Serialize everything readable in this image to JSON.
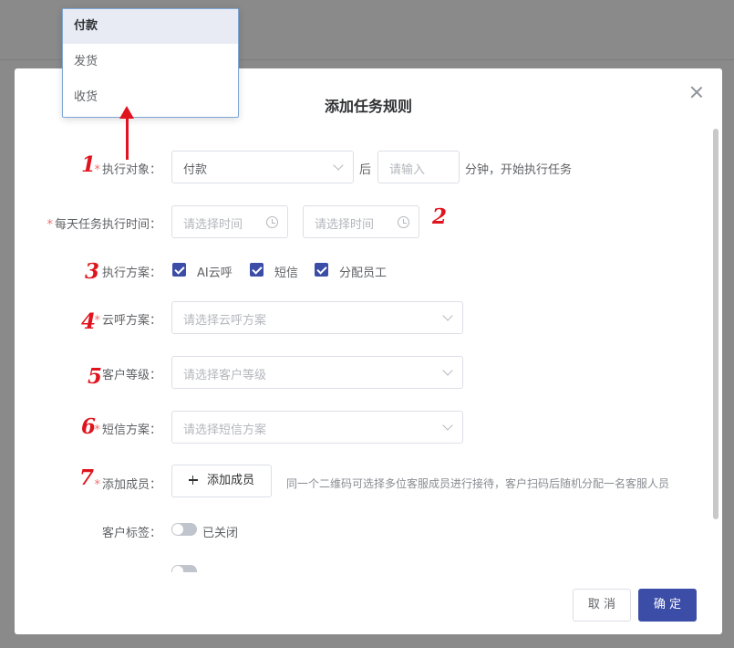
{
  "dialog": {
    "title": "添加任务规则",
    "close_icon": "close-icon"
  },
  "form": {
    "target": {
      "label": "执行对象：",
      "value": "付款",
      "after_text": "后",
      "minutes_placeholder": "请输入",
      "suffix": "分钟，开始执行任务"
    },
    "daily_time": {
      "label": "每天任务执行时间：",
      "start_placeholder": "请选择时间",
      "end_placeholder": "请选择时间"
    },
    "plan": {
      "label": "执行方案：",
      "options": [
        {
          "label": "AI云呼",
          "checked": true
        },
        {
          "label": "短信",
          "checked": true
        },
        {
          "label": "分配员工",
          "checked": true
        }
      ]
    },
    "cloud_call_plan": {
      "label": "云呼方案：",
      "placeholder": "请选择云呼方案"
    },
    "customer_level": {
      "label": "客户等级：",
      "placeholder": "请选择客户等级"
    },
    "sms_plan": {
      "label": "短信方案：",
      "placeholder": "请选择短信方案"
    },
    "members": {
      "label": "添加成员：",
      "button_label": "添加成员",
      "hint": "同一个二维码可选择多位客服成员进行接待，客户扫码后随机分配一名客服人员"
    },
    "customer_tag": {
      "label": "客户标签：",
      "status": "已关闭",
      "enabled": false
    }
  },
  "footer": {
    "cancel_label": "取 消",
    "confirm_label": "确 定"
  },
  "dropdown": {
    "options": [
      "付款",
      "发货",
      "收货"
    ],
    "selected": "付款"
  },
  "annotations": [
    "1",
    "2",
    "3",
    "4",
    "5",
    "6",
    "7"
  ],
  "colors": {
    "primary": "#3c4da8",
    "required": "#f56c6c",
    "annotation": "#e0141e"
  }
}
